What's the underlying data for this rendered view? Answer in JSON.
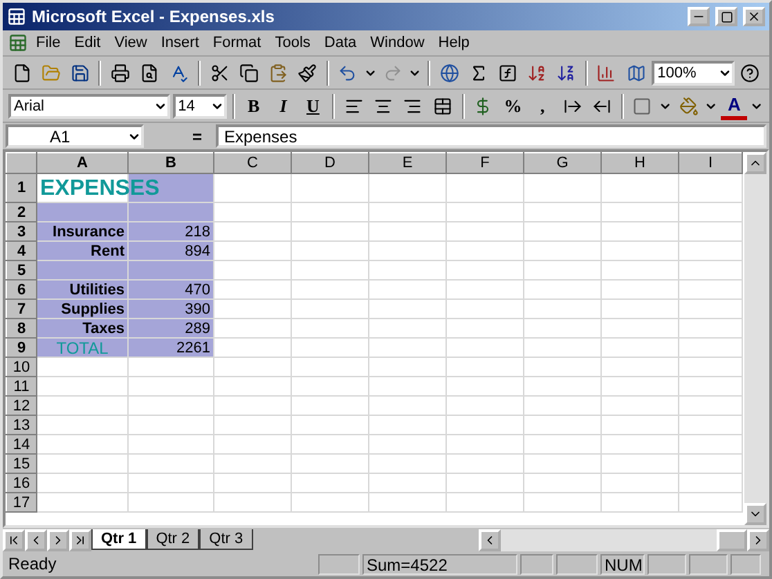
{
  "window": {
    "title": "Microsoft Excel - Expenses.xls"
  },
  "menu": [
    "File",
    "Edit",
    "View",
    "Insert",
    "Format",
    "Tools",
    "Data",
    "Window",
    "Help"
  ],
  "formatting": {
    "font": "Arial",
    "size": "14",
    "zoom": "100%",
    "bold": "B",
    "italic": "I",
    "underline": "U",
    "percent": "%",
    "comma": ",",
    "font_color": "A"
  },
  "formula_bar": {
    "name_box": "A1",
    "equals": "=",
    "value": "Expenses"
  },
  "columns": [
    {
      "label": "A",
      "selected": true
    },
    {
      "label": "B",
      "selected": true
    },
    {
      "label": "C",
      "selected": false
    },
    {
      "label": "D",
      "selected": false
    },
    {
      "label": "E",
      "selected": false
    },
    {
      "label": "F",
      "selected": false
    },
    {
      "label": "G",
      "selected": false
    },
    {
      "label": "H",
      "selected": false
    },
    {
      "label": "I",
      "selected": false
    }
  ],
  "rows": [
    {
      "label": "1",
      "selected": true,
      "kind": "title",
      "a": "EXPENSES"
    },
    {
      "label": "2",
      "selected": true,
      "kind": "item"
    },
    {
      "label": "3",
      "selected": true,
      "kind": "item",
      "a": "Insurance",
      "b": "218"
    },
    {
      "label": "4",
      "selected": true,
      "kind": "item",
      "a": "Rent",
      "b": "894"
    },
    {
      "label": "5",
      "selected": true,
      "kind": "item"
    },
    {
      "label": "6",
      "selected": true,
      "kind": "item",
      "a": "Utilities",
      "b": "470"
    },
    {
      "label": "7",
      "selected": true,
      "kind": "item",
      "a": "Supplies",
      "b": "390"
    },
    {
      "label": "8",
      "selected": true,
      "kind": "item",
      "a": "Taxes",
      "b": "289"
    },
    {
      "label": "9",
      "selected": true,
      "kind": "total",
      "a": "TOTAL",
      "b": "2261"
    },
    {
      "label": "10",
      "selected": false,
      "kind": "item"
    },
    {
      "label": "11",
      "selected": false,
      "kind": "item"
    },
    {
      "label": "12",
      "selected": false,
      "kind": "item"
    },
    {
      "label": "13",
      "selected": false,
      "kind": "item"
    },
    {
      "label": "14",
      "selected": false,
      "kind": "item"
    },
    {
      "label": "15",
      "selected": false,
      "kind": "item"
    },
    {
      "label": "16",
      "selected": false,
      "kind": "item"
    },
    {
      "label": "17",
      "selected": false,
      "kind": "item"
    }
  ],
  "sheet_tabs": [
    {
      "label": "Qtr 1",
      "selected": true
    },
    {
      "label": "Qtr 2",
      "selected": false
    },
    {
      "label": "Qtr 3",
      "selected": false
    }
  ],
  "status_bar": {
    "state": "Ready",
    "sum": "Sum=4522",
    "num": "NUM"
  }
}
